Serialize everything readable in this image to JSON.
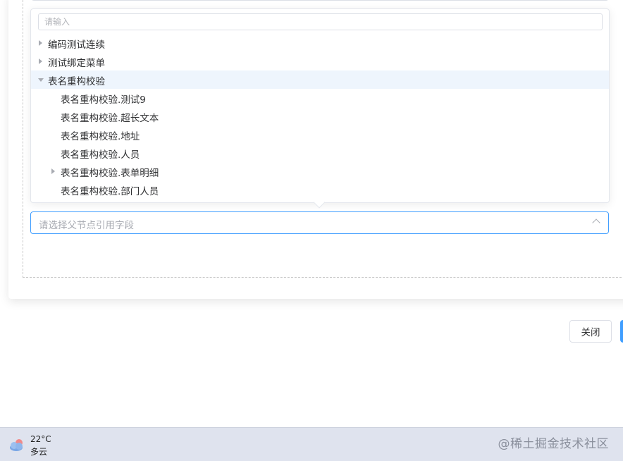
{
  "filter": {
    "placeholder": "请输入"
  },
  "tree": {
    "nodes": [
      {
        "label": "编码测试连续",
        "level": 0,
        "expandable": true,
        "expanded": false
      },
      {
        "label": "测试绑定菜单",
        "level": 0,
        "expandable": true,
        "expanded": false
      },
      {
        "label": "表名重构校验",
        "level": 0,
        "expandable": true,
        "expanded": true,
        "highlighted": true
      },
      {
        "label": "表名重构校验.测试9",
        "level": 1,
        "expandable": false
      },
      {
        "label": "表名重构校验.超长文本",
        "level": 1,
        "expandable": false
      },
      {
        "label": "表名重构校验.地址",
        "level": 1,
        "expandable": false
      },
      {
        "label": "表名重构校验.人员",
        "level": 1,
        "expandable": false
      },
      {
        "label": "表名重构校验.表单明细",
        "level": 1,
        "expandable": true,
        "expanded": false
      },
      {
        "label": "表名重构校验.部门人员",
        "level": 1,
        "expandable": false
      }
    ]
  },
  "select": {
    "placeholder": "请选择父节点引用字段"
  },
  "footer": {
    "close_label": "关闭"
  },
  "taskbar": {
    "weather": {
      "temperature": "22°C",
      "condition": "多云",
      "icon": "cloudy-icon"
    },
    "watermark": "@稀土掘金技术社区"
  },
  "colors": {
    "primary": "#409eff",
    "highlight": "#eef5fd",
    "taskbar": "#dfe3ee"
  }
}
